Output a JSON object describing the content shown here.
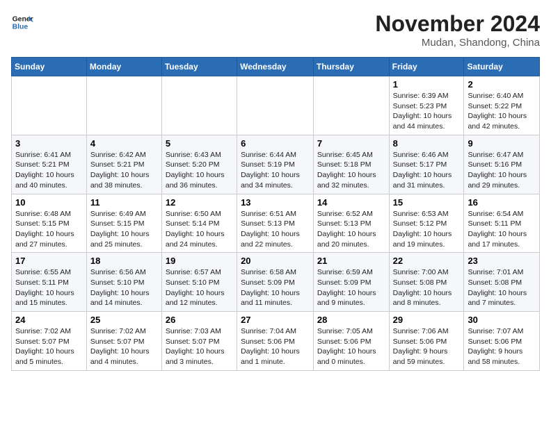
{
  "header": {
    "logo_line1": "General",
    "logo_line2": "Blue",
    "month": "November 2024",
    "location": "Mudan, Shandong, China"
  },
  "weekdays": [
    "Sunday",
    "Monday",
    "Tuesday",
    "Wednesday",
    "Thursday",
    "Friday",
    "Saturday"
  ],
  "weeks": [
    [
      {
        "day": "",
        "info": ""
      },
      {
        "day": "",
        "info": ""
      },
      {
        "day": "",
        "info": ""
      },
      {
        "day": "",
        "info": ""
      },
      {
        "day": "",
        "info": ""
      },
      {
        "day": "1",
        "info": "Sunrise: 6:39 AM\nSunset: 5:23 PM\nDaylight: 10 hours and 44 minutes."
      },
      {
        "day": "2",
        "info": "Sunrise: 6:40 AM\nSunset: 5:22 PM\nDaylight: 10 hours and 42 minutes."
      }
    ],
    [
      {
        "day": "3",
        "info": "Sunrise: 6:41 AM\nSunset: 5:21 PM\nDaylight: 10 hours and 40 minutes."
      },
      {
        "day": "4",
        "info": "Sunrise: 6:42 AM\nSunset: 5:21 PM\nDaylight: 10 hours and 38 minutes."
      },
      {
        "day": "5",
        "info": "Sunrise: 6:43 AM\nSunset: 5:20 PM\nDaylight: 10 hours and 36 minutes."
      },
      {
        "day": "6",
        "info": "Sunrise: 6:44 AM\nSunset: 5:19 PM\nDaylight: 10 hours and 34 minutes."
      },
      {
        "day": "7",
        "info": "Sunrise: 6:45 AM\nSunset: 5:18 PM\nDaylight: 10 hours and 32 minutes."
      },
      {
        "day": "8",
        "info": "Sunrise: 6:46 AM\nSunset: 5:17 PM\nDaylight: 10 hours and 31 minutes."
      },
      {
        "day": "9",
        "info": "Sunrise: 6:47 AM\nSunset: 5:16 PM\nDaylight: 10 hours and 29 minutes."
      }
    ],
    [
      {
        "day": "10",
        "info": "Sunrise: 6:48 AM\nSunset: 5:15 PM\nDaylight: 10 hours and 27 minutes."
      },
      {
        "day": "11",
        "info": "Sunrise: 6:49 AM\nSunset: 5:15 PM\nDaylight: 10 hours and 25 minutes."
      },
      {
        "day": "12",
        "info": "Sunrise: 6:50 AM\nSunset: 5:14 PM\nDaylight: 10 hours and 24 minutes."
      },
      {
        "day": "13",
        "info": "Sunrise: 6:51 AM\nSunset: 5:13 PM\nDaylight: 10 hours and 22 minutes."
      },
      {
        "day": "14",
        "info": "Sunrise: 6:52 AM\nSunset: 5:13 PM\nDaylight: 10 hours and 20 minutes."
      },
      {
        "day": "15",
        "info": "Sunrise: 6:53 AM\nSunset: 5:12 PM\nDaylight: 10 hours and 19 minutes."
      },
      {
        "day": "16",
        "info": "Sunrise: 6:54 AM\nSunset: 5:11 PM\nDaylight: 10 hours and 17 minutes."
      }
    ],
    [
      {
        "day": "17",
        "info": "Sunrise: 6:55 AM\nSunset: 5:11 PM\nDaylight: 10 hours and 15 minutes."
      },
      {
        "day": "18",
        "info": "Sunrise: 6:56 AM\nSunset: 5:10 PM\nDaylight: 10 hours and 14 minutes."
      },
      {
        "day": "19",
        "info": "Sunrise: 6:57 AM\nSunset: 5:10 PM\nDaylight: 10 hours and 12 minutes."
      },
      {
        "day": "20",
        "info": "Sunrise: 6:58 AM\nSunset: 5:09 PM\nDaylight: 10 hours and 11 minutes."
      },
      {
        "day": "21",
        "info": "Sunrise: 6:59 AM\nSunset: 5:09 PM\nDaylight: 10 hours and 9 minutes."
      },
      {
        "day": "22",
        "info": "Sunrise: 7:00 AM\nSunset: 5:08 PM\nDaylight: 10 hours and 8 minutes."
      },
      {
        "day": "23",
        "info": "Sunrise: 7:01 AM\nSunset: 5:08 PM\nDaylight: 10 hours and 7 minutes."
      }
    ],
    [
      {
        "day": "24",
        "info": "Sunrise: 7:02 AM\nSunset: 5:07 PM\nDaylight: 10 hours and 5 minutes."
      },
      {
        "day": "25",
        "info": "Sunrise: 7:02 AM\nSunset: 5:07 PM\nDaylight: 10 hours and 4 minutes."
      },
      {
        "day": "26",
        "info": "Sunrise: 7:03 AM\nSunset: 5:07 PM\nDaylight: 10 hours and 3 minutes."
      },
      {
        "day": "27",
        "info": "Sunrise: 7:04 AM\nSunset: 5:06 PM\nDaylight: 10 hours and 1 minute."
      },
      {
        "day": "28",
        "info": "Sunrise: 7:05 AM\nSunset: 5:06 PM\nDaylight: 10 hours and 0 minutes."
      },
      {
        "day": "29",
        "info": "Sunrise: 7:06 AM\nSunset: 5:06 PM\nDaylight: 9 hours and 59 minutes."
      },
      {
        "day": "30",
        "info": "Sunrise: 7:07 AM\nSunset: 5:06 PM\nDaylight: 9 hours and 58 minutes."
      }
    ]
  ]
}
